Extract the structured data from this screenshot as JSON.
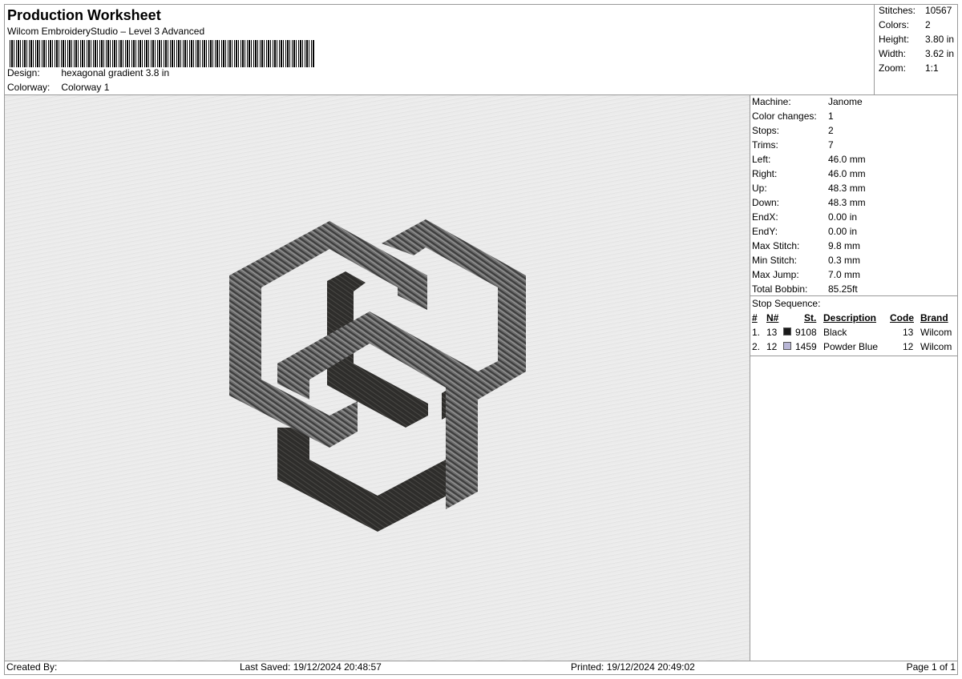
{
  "header": {
    "title": "Production Worksheet",
    "subtitle": "Wilcom EmbroideryStudio – Level 3 Advanced",
    "design_label": "Design:",
    "design_value": "hexagonal gradient 3.8 in",
    "colorway_label": "Colorway:",
    "colorway_value": "Colorway 1"
  },
  "summary": [
    {
      "label": "Stitches:",
      "value": "10567"
    },
    {
      "label": "Colors:",
      "value": "2"
    },
    {
      "label": "Height:",
      "value": "3.80 in"
    },
    {
      "label": "Width:",
      "value": "3.62 in"
    },
    {
      "label": "Zoom:",
      "value": "1:1"
    }
  ],
  "machine_info": [
    {
      "label": "Machine:",
      "value": "Janome"
    },
    {
      "label": "Color changes:",
      "value": "1"
    },
    {
      "label": "Stops:",
      "value": "2"
    },
    {
      "label": "Trims:",
      "value": "7"
    },
    {
      "label": "Left:",
      "value": "46.0 mm"
    },
    {
      "label": "Right:",
      "value": "46.0 mm"
    },
    {
      "label": "Up:",
      "value": "48.3 mm"
    },
    {
      "label": "Down:",
      "value": "48.3 mm"
    },
    {
      "label": "EndX:",
      "value": "0.00 in"
    },
    {
      "label": "EndY:",
      "value": "0.00 in"
    },
    {
      "label": "Max Stitch:",
      "value": "9.8 mm"
    },
    {
      "label": "Min Stitch:",
      "value": "0.3 mm"
    },
    {
      "label": "Max Jump:",
      "value": "7.0 mm"
    },
    {
      "label": "Total Bobbin:",
      "value": "85.25ft"
    }
  ],
  "stop_sequence": {
    "title": "Stop Sequence:",
    "headers": {
      "num": "#",
      "n": "N#",
      "st": "St.",
      "description": "Description",
      "code": "Code",
      "brand": "Brand"
    },
    "rows": [
      {
        "num": "1.",
        "n": "13",
        "color": "#1a1a1a",
        "st": "9108",
        "description": "Black",
        "code": "13",
        "brand": "Wilcom"
      },
      {
        "num": "2.",
        "n": "12",
        "color": "#b8b6d6",
        "st": "1459",
        "description": "Powder Blue",
        "code": "12",
        "brand": "Wilcom"
      }
    ]
  },
  "footer": {
    "created_by": "Created By:",
    "last_saved": "Last Saved: 19/12/2024 20:48:57",
    "printed": "Printed: 19/12/2024 20:49:02",
    "page": "Page 1 of 1"
  },
  "colors": {
    "thread_dark": "#2e2d2b",
    "thread_mid": "#5a5a5a",
    "background": "#e9e9e9"
  }
}
